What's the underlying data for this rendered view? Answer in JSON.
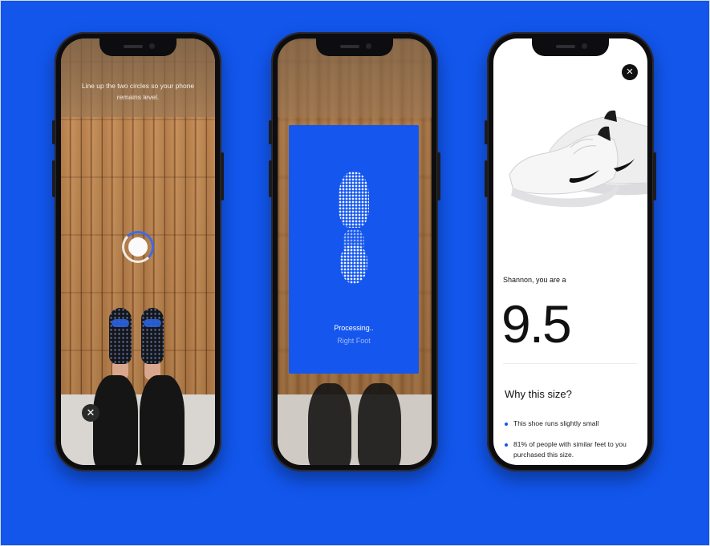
{
  "phone1": {
    "instruction": "Line up the two circles so your phone remains level.",
    "close_label": "✕"
  },
  "phone2": {
    "status": "Processing..",
    "foot_label": "Right Foot"
  },
  "phone3": {
    "close_label": "✕",
    "greeting": "Shannon, you are a",
    "size": "9.5",
    "why_title": "Why this size?",
    "reasons": [
      "This shoe runs slightly small",
      "81% of people with similar feet to you purchased this size."
    ]
  },
  "colors": {
    "background": "#1256ec",
    "processing_card": "#1557ee",
    "accent_ring": "#3e6be8"
  },
  "icons": {
    "close": "close-icon",
    "level": "level-indicator-icon",
    "swoosh": "nike-swoosh-icon"
  }
}
